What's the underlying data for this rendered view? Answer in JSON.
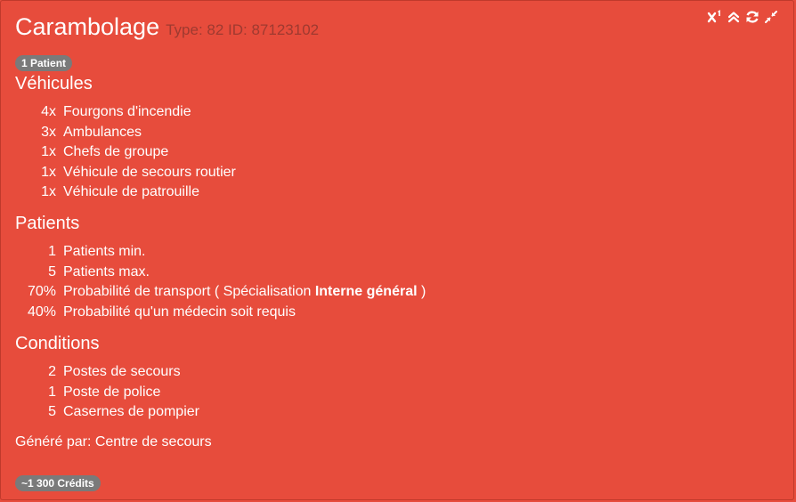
{
  "mission": {
    "title": "Carambolage",
    "meta": "Type: 82 ID: 87123102",
    "patient_badge": "1 Patient",
    "credits_badge": "~1 300 Crédits"
  },
  "icons": {
    "superscript": "superscript-icon",
    "collapse": "chevrons-up-icon",
    "refresh": "refresh-icon",
    "compress": "compress-icon"
  },
  "sections": {
    "vehicles": {
      "title": "Véhicules",
      "items": [
        {
          "count": "4x",
          "label": "Fourgons d'incendie"
        },
        {
          "count": "3x",
          "label": "Ambulances"
        },
        {
          "count": "1x",
          "label": "Chefs de groupe"
        },
        {
          "count": "1x",
          "label": "Véhicule de secours routier"
        },
        {
          "count": "1x",
          "label": "Véhicule de patrouille"
        }
      ]
    },
    "patients": {
      "title": "Patients",
      "items": [
        {
          "count": "1",
          "label": "Patients min."
        },
        {
          "count": "5",
          "label": "Patients max."
        },
        {
          "count": "70%",
          "label": "Probabilité de transport ( Spécialisation ",
          "bold": "Interne général",
          "after": " )"
        },
        {
          "count": "40%",
          "label": "Probabilité qu'un médecin soit requis"
        }
      ]
    },
    "conditions": {
      "title": "Conditions",
      "items": [
        {
          "count": "2",
          "label": "Postes de secours"
        },
        {
          "count": "1",
          "label": "Poste de police"
        },
        {
          "count": "5",
          "label": "Casernes de pompier"
        }
      ]
    }
  },
  "generated_by": "Généré par: Centre de secours",
  "colors": {
    "background": "#e74c3c",
    "meta_text": "#9e3a30",
    "badge": "#7a7a7a",
    "text": "#ffffff"
  }
}
